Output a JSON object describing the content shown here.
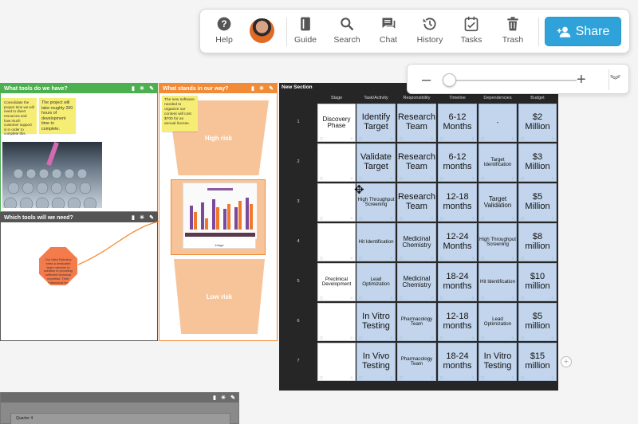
{
  "toolbar": {
    "items": [
      {
        "label": "Help",
        "icon": "help-icon"
      },
      {
        "label": "Guide",
        "icon": "guide-icon"
      },
      {
        "label": "Search",
        "icon": "search-icon"
      },
      {
        "label": "Chat",
        "icon": "chat-icon"
      },
      {
        "label": "History",
        "icon": "history-icon"
      },
      {
        "label": "Tasks",
        "icon": "tasks-icon"
      },
      {
        "label": "Trash",
        "icon": "trash-icon"
      }
    ],
    "share_label": "Share",
    "accent": "#2fa3d9"
  },
  "zoom": {
    "minus": "–",
    "plus": "+",
    "level_fraction": 0.05
  },
  "sections": {
    "tools_have": {
      "title": "What tools do we have?",
      "color": "#4caf50"
    },
    "tools_need": {
      "title": "Which tools will we need?",
      "color": "#555555"
    },
    "obstacles": {
      "title": "What stands in our way?",
      "color": "#f28b36"
    },
    "new_section": {
      "title": "New Section",
      "color": "#262626"
    },
    "quarter": {
      "title": "Quarter 4"
    }
  },
  "stickies": {
    "s1": "Consolidate the project time we will need to divert resources and how much customer support is in order to complete this.",
    "s2": "The project will take roughly 200 hours of development time to complete.",
    "s3": "The new software needed to organize our content will cost $700 for an annual license."
  },
  "risks": {
    "high": "High risk",
    "low": "Low risk"
  },
  "octagon_text": "Our Ultra Robotics hired a dedicated team member in addition to providing sufficient technical expertise. Their professional time early",
  "chart_card": {
    "label": "Image"
  },
  "table": {
    "headers": [
      "Stage",
      "Task/Activity",
      "Responsibility",
      "Timeline",
      "Dependencies",
      "Budget"
    ],
    "rows": [
      {
        "num": "1",
        "stage": "Discovery Phase",
        "task": "Identify Target",
        "resp": "Research Team",
        "time": "6-12 Months",
        "dep": "-",
        "budget": "$2 Million"
      },
      {
        "num": "2",
        "stage": "",
        "task": "Validate Target",
        "resp": "Research Team",
        "time": "6-12 months",
        "dep": "Target Identification",
        "budget": "$3 Million"
      },
      {
        "num": "3",
        "stage": "",
        "task": "High Throughput Screening",
        "resp": "Research Team",
        "time": "12-18 months",
        "dep": "Target Validation",
        "budget": "$5 Million"
      },
      {
        "num": "4",
        "stage": "",
        "task": "Hit Identification",
        "resp": "Medicinal Chemistry",
        "time": "12-24 Months",
        "dep": "High Throughput Screening",
        "budget": "$8 million"
      },
      {
        "num": "5",
        "stage": "Preclinical Development",
        "task": "Lead Optimization",
        "resp": "Medicinal Chemistry",
        "time": "18-24 months",
        "dep": "Hit Identification",
        "budget": "$10 million"
      },
      {
        "num": "6",
        "stage": "",
        "task": "In Vitro Testing",
        "resp": "Pharmacology Team",
        "time": "12-18 months",
        "dep": "Lead Optimization",
        "budget": "$5 million"
      },
      {
        "num": "7",
        "stage": "",
        "task": "In Vivo Testing",
        "resp": "Pharmacology Team",
        "time": "18-24 months",
        "dep": "In Vitro Testing",
        "budget": "$15 million"
      }
    ]
  }
}
